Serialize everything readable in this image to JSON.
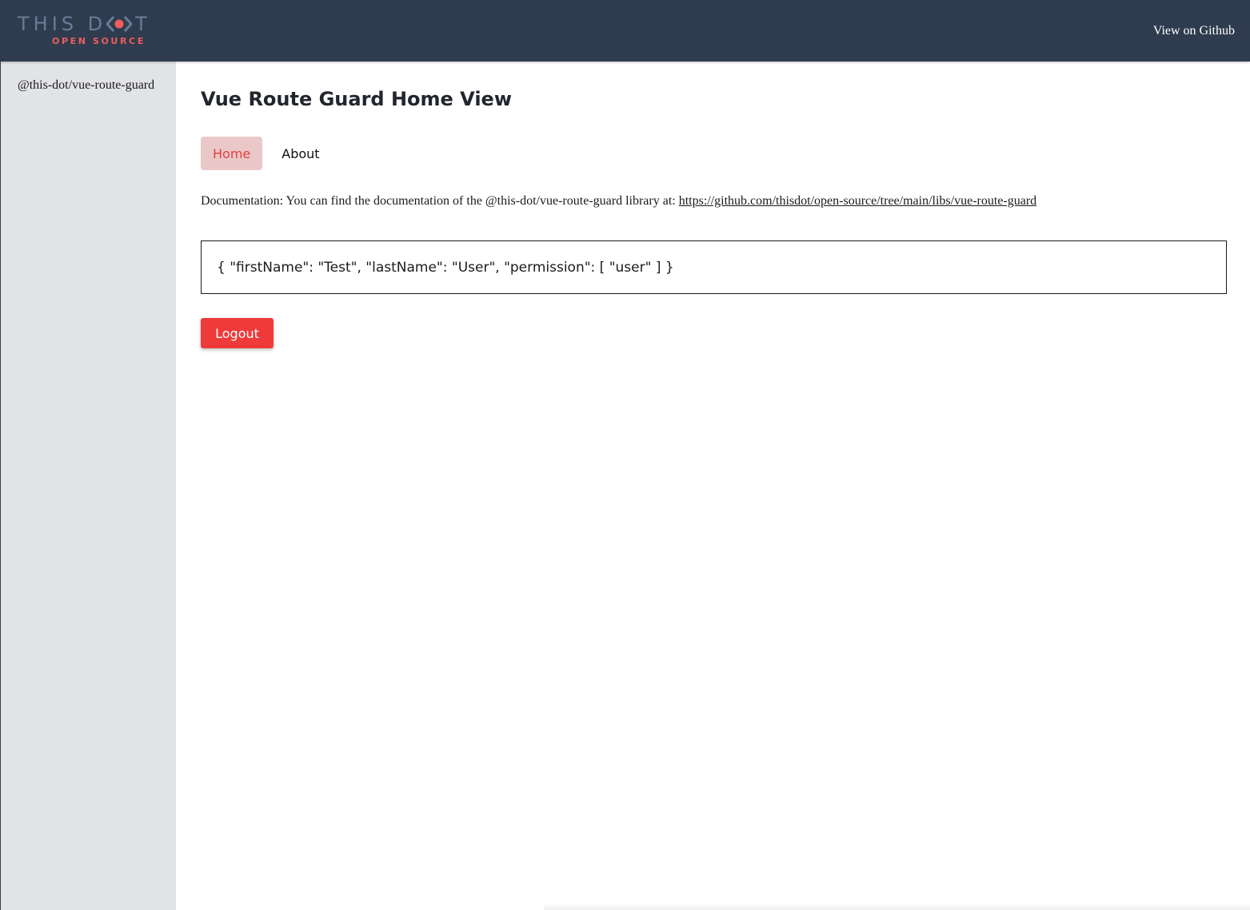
{
  "header": {
    "logo": {
      "top_left": "THIS D",
      "top_right": "T",
      "bottom": "OPEN SOURCE"
    },
    "github_link": "View on Github"
  },
  "sidebar": {
    "items": [
      {
        "label": "@this-dot/vue-route-guard"
      }
    ]
  },
  "main": {
    "title": "Vue Route Guard Home View",
    "tabs": [
      {
        "label": "Home",
        "active": true
      },
      {
        "label": "About",
        "active": false
      }
    ],
    "documentation": {
      "prefix": "Documentation: You can find the documentation of the @this-dot/vue-route-guard library at: ",
      "link": "https://github.com/thisdot/open-source/tree/main/libs/vue-route-guard"
    },
    "user_json": "{ \"firstName\": \"Test\", \"lastName\": \"User\", \"permission\": [ \"user\" ] }",
    "logout_label": "Logout"
  },
  "colors": {
    "header_bg": "#2f3c4f",
    "sidebar_bg": "#e2e3e6",
    "accent_red": "#ef3a3a",
    "active_tab_bg": "#ebc8c8",
    "active_tab_text": "#e0413f",
    "logo_gray": "#6c7a97",
    "logo_red": "#ef5d5d"
  }
}
